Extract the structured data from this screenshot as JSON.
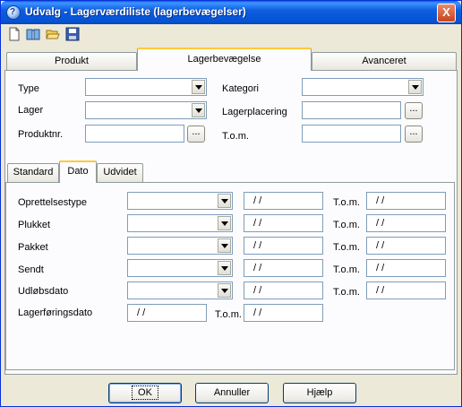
{
  "window": {
    "title": "Udvalg - Lagerværdiliste (lagerbevægelser)",
    "close_glyph": "X"
  },
  "toolbar": {
    "icons": [
      "new-document-icon",
      "book-icon",
      "open-folder-icon",
      "save-icon"
    ]
  },
  "main_tabs": [
    "Produkt",
    "Lagerbevægelse",
    "Avanceret"
  ],
  "main_active_tab": "Lagerbevægelse",
  "filters": {
    "type_label": "Type",
    "lager_label": "Lager",
    "produktnr_label": "Produktnr.",
    "kategori_label": "Kategori",
    "lagerplacering_label": "Lagerplacering",
    "tom_label": "T.o.m.",
    "ellipsis": "..."
  },
  "sub_tabs": [
    "Standard",
    "Dato",
    "Udvidet"
  ],
  "sub_active_tab": "Dato",
  "date_rows": [
    {
      "label": "Oprettelsestype",
      "from": " / /",
      "tom_label": "T.o.m.",
      "to": " / /"
    },
    {
      "label": "Plukket",
      "from": " / /",
      "tom_label": "T.o.m.",
      "to": " / /"
    },
    {
      "label": "Pakket",
      "from": " / /",
      "tom_label": "T.o.m.",
      "to": " / /"
    },
    {
      "label": "Sendt",
      "from": " / /",
      "tom_label": "T.o.m.",
      "to": " / /"
    },
    {
      "label": "Udløbsdato",
      "from": " / /",
      "tom_label": "T.o.m.",
      "to": " / /"
    }
  ],
  "lagerforing": {
    "label": "Lagerføringsdato",
    "from": " / /",
    "tom_label": "T.o.m.",
    "to": " / /"
  },
  "buttons": {
    "ok": "OK",
    "cancel": "Annuller",
    "help": "Hjælp"
  }
}
